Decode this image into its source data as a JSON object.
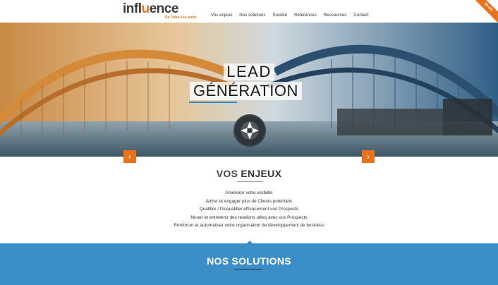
{
  "header": {
    "logo_text_a": "infl",
    "logo_text_b": "u",
    "logo_text_c": "ence",
    "logo_tagline": "De l'idée à la vente",
    "nav": [
      "Vos enjeux",
      "Nos solutions",
      "Société",
      "Références",
      "Ressources",
      "Contact"
    ],
    "ribbon": "BLOG"
  },
  "hero": {
    "line1": "LEAD",
    "line2": "GÉNÉRATION",
    "prev_icon": "chevron-left-icon",
    "next_icon": "chevron-right-icon"
  },
  "enjeux": {
    "title_light": "VOS ",
    "title_bold": "ENJEUX",
    "items": [
      "Améliorer votre visibilité",
      "Attirer et engager plus de Clients potentiels",
      "Qualifier / Disqualifier efficacement vos Prospects",
      "Nouer et entretenir des relations utiles avec vos Prospects",
      "Renforcer et automatiser votre organisation de développement de business"
    ]
  },
  "solutions": {
    "title_light": "NOS ",
    "title_bold": "SOLUTIONS"
  },
  "colors": {
    "accent": "#e8731c",
    "blue": "#3b8fc6",
    "hero_underline": "#2a89c6"
  }
}
